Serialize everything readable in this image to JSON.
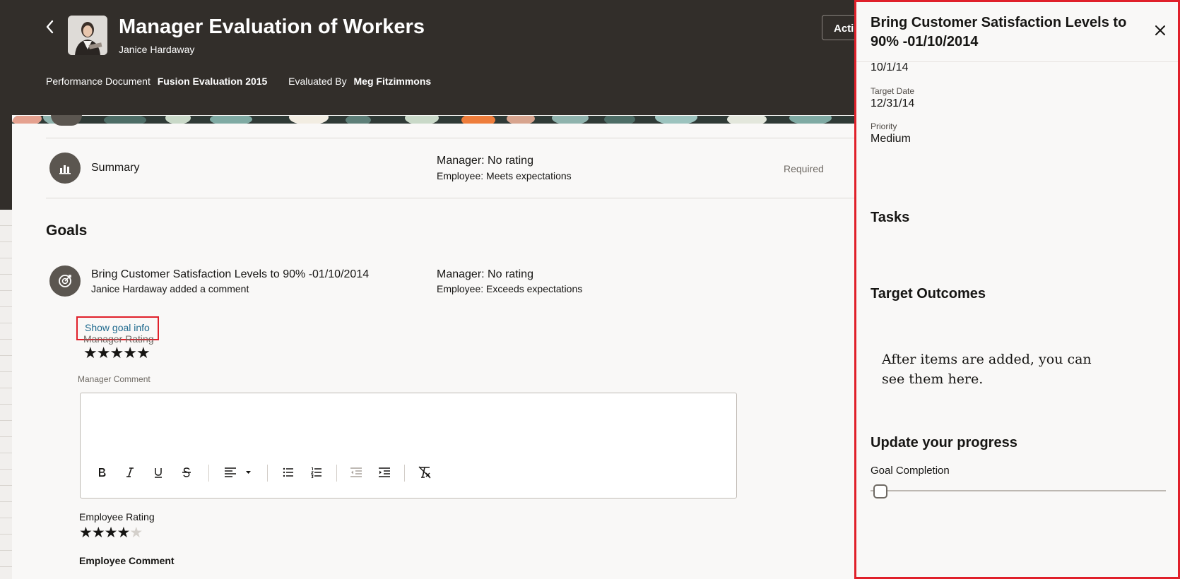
{
  "header": {
    "title": "Manager Evaluation of Workers",
    "subtitle": "Janice Hardaway",
    "doc_label": "Performance Document",
    "doc_value": "Fusion Evaluation 2015",
    "eval_label": "Evaluated By",
    "eval_value": "Meg Fitzimmons",
    "actions_label": "Actions"
  },
  "summary": {
    "label": "Summary",
    "manager": "Manager: No rating",
    "employee": "Employee: Meets expectations",
    "required": "Required"
  },
  "goals": {
    "heading": "Goals",
    "goal_title": "Bring Customer Satisfaction Levels to 90% -01/10/2014",
    "goal_comment": "Janice Hardaway added a comment",
    "manager": "Manager: No rating",
    "employee": "Employee: Exceeds expectations",
    "show_info": "Show goal info",
    "manager_rating_label": "Manager Rating",
    "manager_rating_stars": 5,
    "manager_comment_label": "Manager Comment",
    "employee_rating_label": "Employee Rating",
    "employee_rating_stars": 4,
    "employee_comment_label": "Employee Comment"
  },
  "toolbar": {
    "icons": [
      "bold-icon",
      "italic-icon",
      "underline-icon",
      "strikethrough-icon",
      "align-icon",
      "bullet-list-icon",
      "numbered-list-icon",
      "outdent-icon",
      "indent-icon",
      "clear-format-icon"
    ]
  },
  "panel": {
    "title": "Bring Customer Satisfaction Levels to 90% -01/10/2014",
    "start_value": "10/1/14",
    "target_label": "Target Date",
    "target_value": "12/31/14",
    "priority_label": "Priority",
    "priority_value": "Medium",
    "tasks_heading": "Tasks",
    "outcomes_heading": "Target Outcomes",
    "empty_text": "After items are added, you can see them here.",
    "progress_heading": "Update your progress",
    "completion_label": "Goal Completion",
    "completion_value": 0
  },
  "colors": {
    "header_bg": "#322e2a",
    "highlight_border": "#e0202a",
    "link": "#1f6a8e"
  }
}
